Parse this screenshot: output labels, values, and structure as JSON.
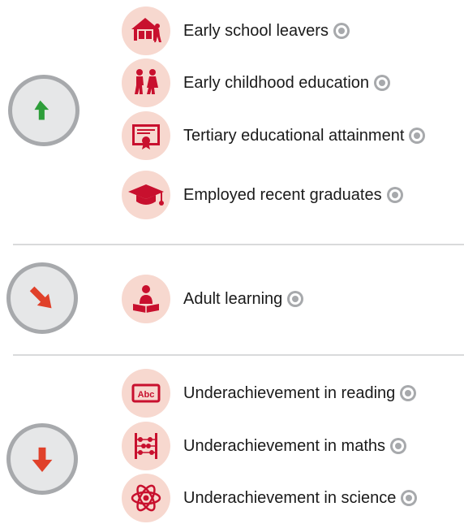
{
  "colors": {
    "improving": "#2e9e3a",
    "mixed": "#e0412a",
    "worsening": "#e0412a",
    "icon_accent": "#c8102e",
    "icon_background": "#f7d8cf",
    "circle_fill": "#e6e7e8",
    "circle_border": "#a7a9ac"
  },
  "groups": [
    {
      "trend": "up",
      "trend_icon": "arrow-up-icon",
      "items": [
        {
          "label": "Early school leavers",
          "icon": "school-building-icon"
        },
        {
          "label": "Early childhood education",
          "icon": "children-walking-icon"
        },
        {
          "label": "Tertiary educational attainment",
          "icon": "diploma-certificate-icon"
        },
        {
          "label": "Employed recent graduates",
          "icon": "graduation-cap-icon"
        }
      ]
    },
    {
      "trend": "down-right",
      "trend_icon": "arrow-down-right-icon",
      "items": [
        {
          "label": "Adult learning",
          "icon": "person-reading-icon"
        }
      ]
    },
    {
      "trend": "down",
      "trend_icon": "arrow-down-icon",
      "items": [
        {
          "label": "Underachievement in reading",
          "icon": "abc-sign-icon"
        },
        {
          "label": "Underachievement in maths",
          "icon": "abacus-icon"
        },
        {
          "label": "Underachievement in science",
          "icon": "atom-icon"
        }
      ]
    }
  ],
  "target_icon": "target-icon"
}
